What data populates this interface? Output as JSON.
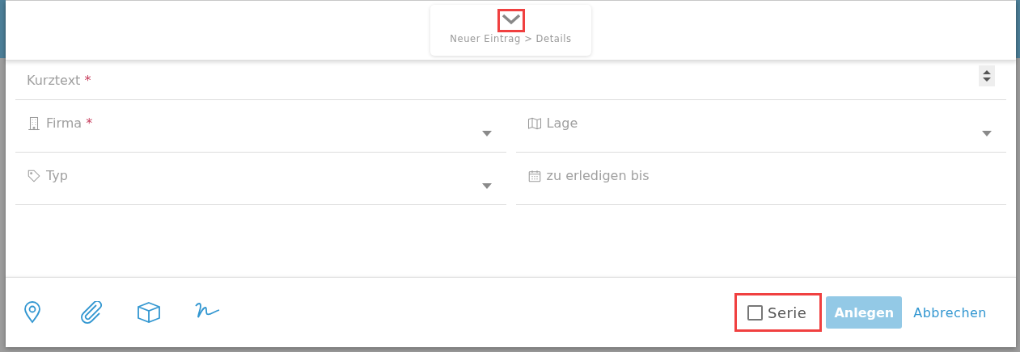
{
  "header": {
    "breadcrumb": "Neuer Eintrag > Details"
  },
  "fields": [
    {
      "label": "Kurztext",
      "required_mark": "*",
      "kind": "text"
    },
    {
      "label": "Firma",
      "required_mark": "*",
      "kind": "select"
    },
    {
      "label": "Lage",
      "kind": "select"
    },
    {
      "label": "Typ",
      "kind": "select"
    },
    {
      "label": "zu erledigen bis",
      "kind": "date"
    }
  ],
  "footer": {
    "series": {
      "label": "Serie",
      "checked": false
    },
    "create_button": {
      "label": "Anlegen",
      "disabled": true
    },
    "cancel_link": "Abbrechen"
  }
}
